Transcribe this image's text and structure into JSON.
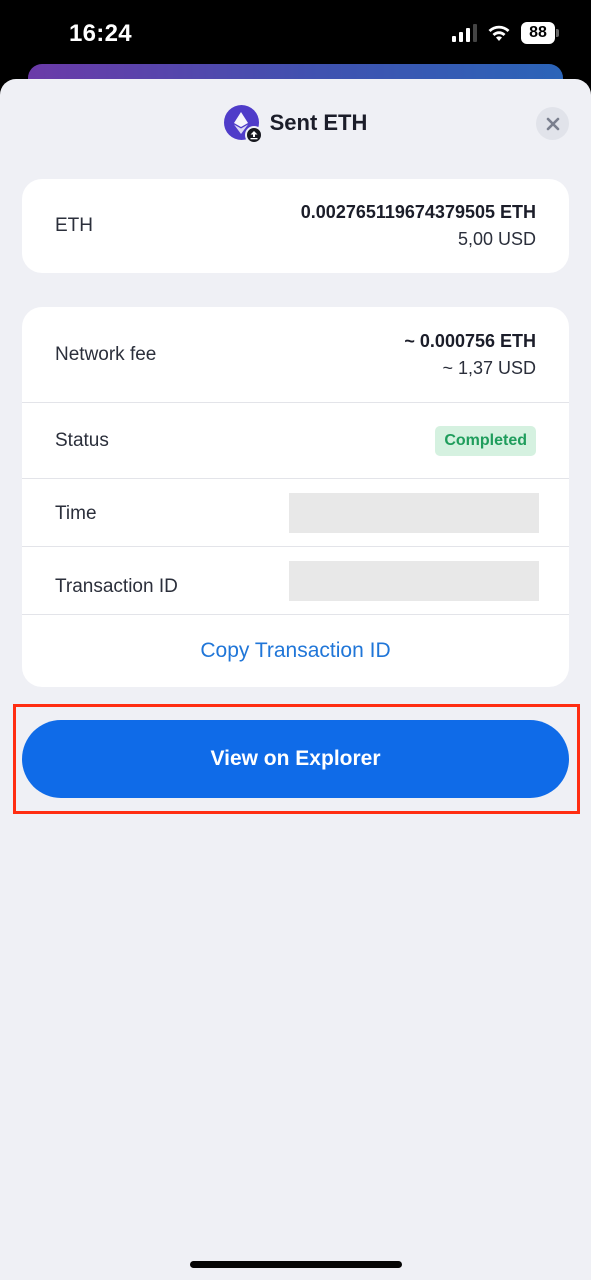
{
  "status_bar": {
    "time": "16:24",
    "battery": "88",
    "signal_icon": "cellular-signal-icon",
    "wifi_icon": "wifi-icon"
  },
  "header": {
    "title": "Sent ETH",
    "coin_icon": "ethereum-icon",
    "badge_icon": "upload-arrow-icon",
    "close_icon": "close-icon"
  },
  "amount": {
    "label": "ETH",
    "crypto_value": "0.002765119674379505 ETH",
    "fiat_value": "5,00 USD"
  },
  "details": {
    "network_fee": {
      "label": "Network fee",
      "crypto_value": "~ 0.000756 ETH",
      "fiat_value": "~ 1,37 USD"
    },
    "status": {
      "label": "Status",
      "value": "Completed",
      "color": "#1f9d5c",
      "background": "#d5f1e0"
    },
    "time": {
      "label": "Time",
      "value_redacted": true
    },
    "transaction_id": {
      "label": "Transaction ID",
      "value_redacted": true
    },
    "copy_label": "Copy Transaction ID"
  },
  "actions": {
    "view_explorer_label": "View on Explorer",
    "primary_color": "#0f6be8"
  }
}
